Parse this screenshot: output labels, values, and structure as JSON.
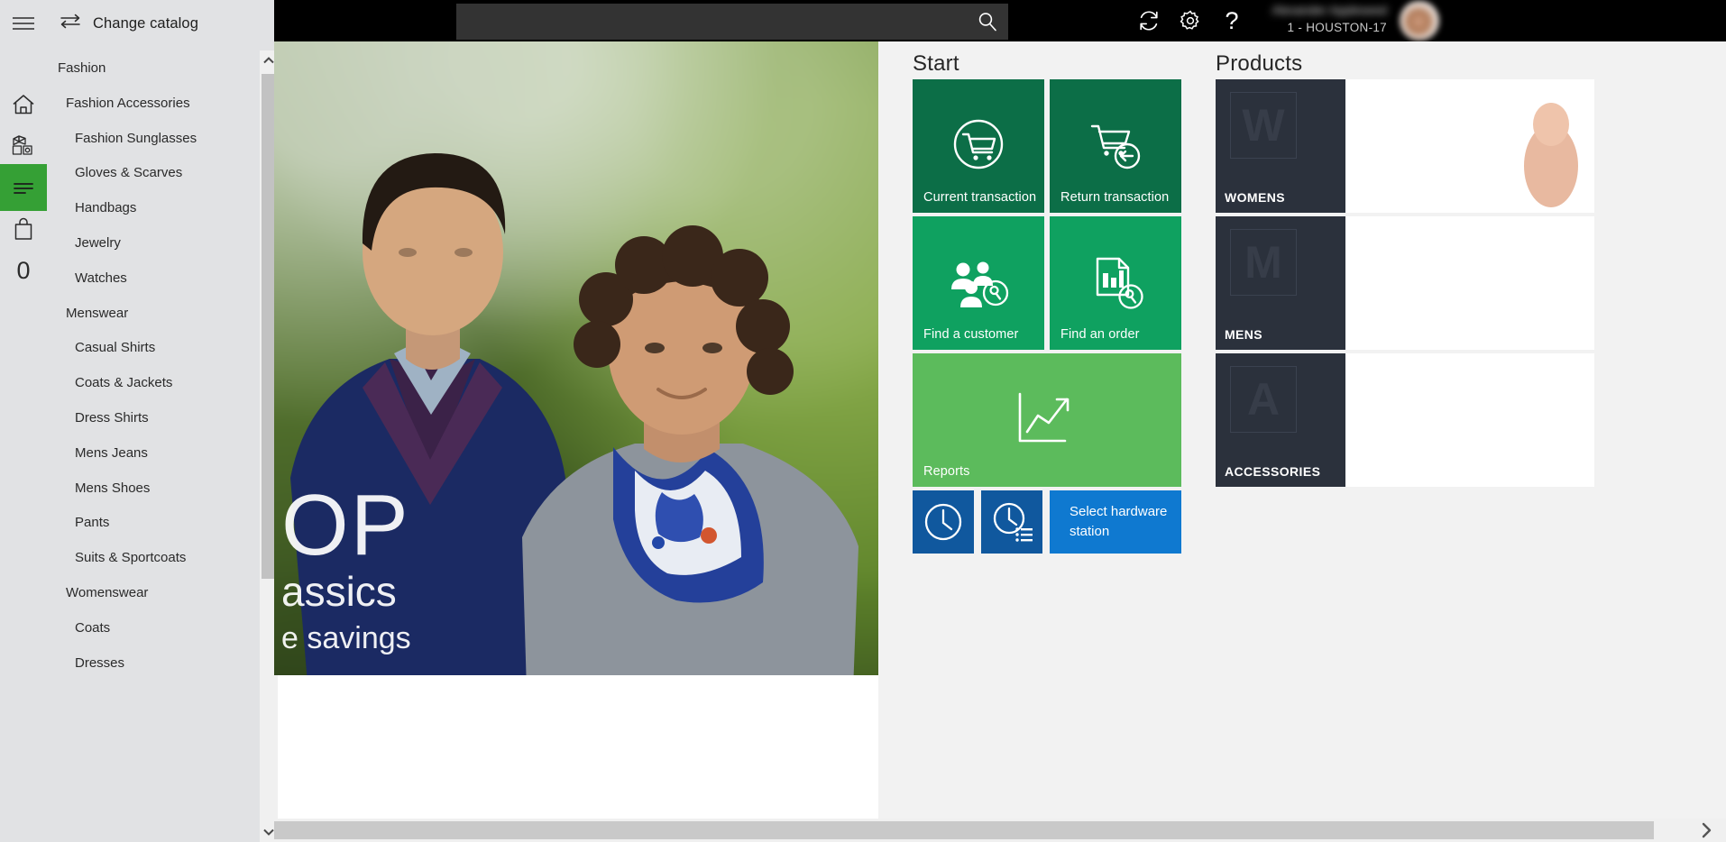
{
  "sidebar": {
    "hamburger_icon": "hamburger-menu-icon",
    "change_catalog": {
      "label": "Change catalog",
      "icon": "swap-arrows-icon"
    },
    "rail": [
      {
        "name": "home",
        "icon": "home-icon",
        "active": false
      },
      {
        "name": "products",
        "icon": "boxes-icon",
        "active": false
      },
      {
        "name": "catalog",
        "icon": "lines-list-icon",
        "active": true
      },
      {
        "name": "shopping-bag",
        "icon": "shopping-bag-icon",
        "active": false
      },
      {
        "name": "zero-count",
        "icon": "zero-glyph-icon",
        "active": false
      }
    ],
    "catalog": [
      {
        "type": "group",
        "label": "Fashion"
      },
      {
        "type": "item",
        "label": "Fashion Accessories"
      },
      {
        "type": "sub",
        "label": "Fashion Sunglasses"
      },
      {
        "type": "sub",
        "label": "Gloves & Scarves"
      },
      {
        "type": "sub",
        "label": "Handbags"
      },
      {
        "type": "sub",
        "label": "Jewelry"
      },
      {
        "type": "sub",
        "label": "Watches"
      },
      {
        "type": "item",
        "label": "Menswear"
      },
      {
        "type": "sub",
        "label": "Casual Shirts"
      },
      {
        "type": "sub",
        "label": "Coats & Jackets"
      },
      {
        "type": "sub",
        "label": "Dress Shirts"
      },
      {
        "type": "sub",
        "label": "Mens Jeans"
      },
      {
        "type": "sub",
        "label": "Mens Shoes"
      },
      {
        "type": "sub",
        "label": "Pants"
      },
      {
        "type": "sub",
        "label": "Suits & Sportcoats"
      },
      {
        "type": "item",
        "label": "Womenswear"
      },
      {
        "type": "sub",
        "label": "Coats"
      },
      {
        "type": "sub",
        "label": "Dresses"
      }
    ]
  },
  "topbar": {
    "search": {
      "value": "",
      "placeholder": "",
      "icon": "search-icon"
    },
    "icons": [
      {
        "name": "refresh-icon"
      },
      {
        "name": "gear-icon"
      },
      {
        "name": "help-question-icon"
      }
    ],
    "user": {
      "name": "Alexander Appleseed",
      "store": "1 - HOUSTON-17",
      "avatar_icon": "user-avatar"
    }
  },
  "hero": {
    "line1": "OP",
    "line2": "assics",
    "line3": "e savings"
  },
  "start": {
    "title": "Start",
    "tiles": [
      {
        "label": "Current transaction",
        "icon": "cart-circle-icon",
        "color": "#0c6e47"
      },
      {
        "label": "Return transaction",
        "icon": "cart-return-icon",
        "color": "#0c6e47"
      },
      {
        "label": "Find a customer",
        "icon": "customers-search-icon",
        "color": "#0fa160"
      },
      {
        "label": "Find an order",
        "icon": "order-search-icon",
        "color": "#0fa160"
      },
      {
        "label": "Reports",
        "icon": "chart-arrow-icon",
        "color": "#5cbb5c"
      }
    ],
    "bottom_tiles": [
      {
        "label": "",
        "icon": "clock-icon",
        "color": "#10589e"
      },
      {
        "label": "",
        "icon": "clock-list-icon",
        "color": "#10589e"
      },
      {
        "label": "Select hardware station",
        "icon": "",
        "color": "#0f79d0"
      }
    ]
  },
  "products": {
    "title": "Products",
    "tiles": [
      {
        "name": "WOMENS",
        "letter": "W"
      },
      {
        "name": "MENS",
        "letter": "M"
      },
      {
        "name": "ACCESSORIES",
        "letter": "A"
      }
    ]
  },
  "scrollbars": {
    "vertical_up_icon": "chevron-up-icon",
    "vertical_down_icon": "chevron-down-icon",
    "horizontal_right_icon": "chevron-right-icon"
  },
  "colors": {
    "sidebar_bg": "#e1e2e4",
    "accent_green": "#35a035",
    "tile_dark_green": "#0c6e47",
    "tile_mid_green": "#0fa160",
    "tile_light_green": "#5cbb5c",
    "tile_dark_blue": "#10589e",
    "tile_bright_blue": "#0f79d0",
    "content_bg": "#f2f2f2",
    "topbar_bg": "#000000",
    "product_placeholder": "#2b313c"
  }
}
